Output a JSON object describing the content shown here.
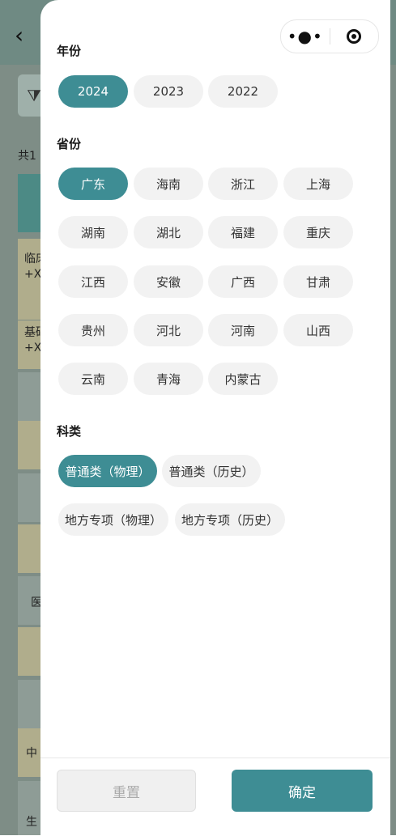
{
  "background": {
    "count_prefix": "共1",
    "rows": [
      "临床",
      "+X",
      "基础",
      "+X",
      "医",
      "中",
      "生"
    ]
  },
  "capsule": {
    "more_icon": "more-dots-icon",
    "close_icon": "target-circle-icon"
  },
  "year": {
    "title": "年份",
    "options": [
      "2024",
      "2023",
      "2022"
    ],
    "selected": "2024"
  },
  "province": {
    "title": "省份",
    "options": [
      "广东",
      "海南",
      "浙江",
      "上海",
      "湖南",
      "湖北",
      "福建",
      "重庆",
      "江西",
      "安徽",
      "广西",
      "甘肃",
      "贵州",
      "河北",
      "河南",
      "山西",
      "云南",
      "青海",
      "内蒙古"
    ],
    "selected": "广东"
  },
  "category": {
    "title": "科类",
    "options": [
      "普通类（物理）",
      "普通类（历史）",
      "地方专项（物理）",
      "地方专项（历史）"
    ],
    "selected": "普通类（物理）"
  },
  "footer": {
    "reset_label": "重置",
    "confirm_label": "确定"
  },
  "colors": {
    "accent": "#3e8d94",
    "chip_bg": "#f2f2f2"
  }
}
